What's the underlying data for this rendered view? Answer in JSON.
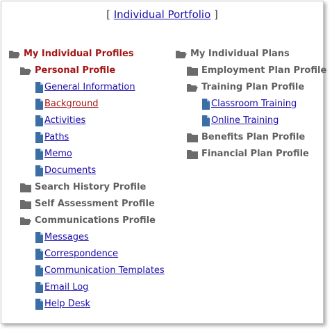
{
  "header": {
    "bracket_open": "[",
    "link": "Individual Portfolio",
    "bracket_close": "]"
  },
  "left_tree": {
    "root": "My Individual Profiles",
    "personal_profile": "Personal Profile",
    "personal_items": [
      "General Information",
      "Background",
      "Activities",
      "Paths",
      "Memo",
      "Documents"
    ],
    "search_history": "Search History Profile",
    "self_assessment": "Self Assessment Profile",
    "communications": "Communications Profile",
    "communications_items": [
      "Messages",
      "Correspondence",
      "Communication Templates",
      "Email Log",
      "Help Desk"
    ]
  },
  "right_tree": {
    "root": "My Individual Plans",
    "employment_plan": "Employment Plan Profile",
    "training_plan": "Training Plan Profile",
    "training_items": [
      "Classroom Training",
      "Online Training"
    ],
    "benefits_plan": "Benefits Plan Profile",
    "financial_plan": "Financial Plan Profile"
  },
  "colors": {
    "link": "#1a0dab",
    "active": "#a31515",
    "folder_text": "#5f5f5f",
    "folder_icon": "#6b6b6b",
    "doc_icon": "#3a6ea5"
  }
}
